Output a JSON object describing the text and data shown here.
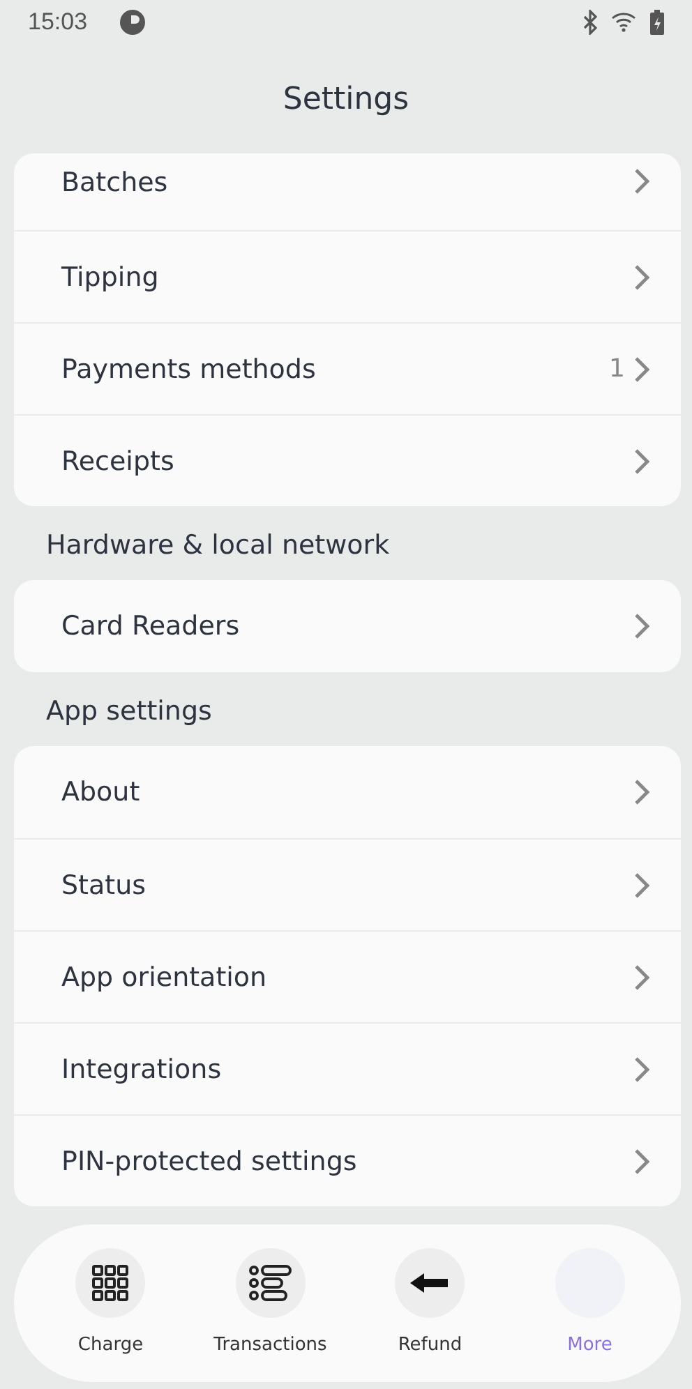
{
  "status_bar": {
    "time": "15:03"
  },
  "title": "Settings",
  "sections": [
    {
      "items": [
        {
          "label": "Batches"
        },
        {
          "label": "Tipping"
        },
        {
          "label": "Payments methods",
          "count": "1"
        },
        {
          "label": "Receipts"
        }
      ]
    },
    {
      "header": "Hardware & local network",
      "items": [
        {
          "label": "Card Readers"
        }
      ]
    },
    {
      "header": "App settings",
      "items": [
        {
          "label": "About"
        },
        {
          "label": "Status"
        },
        {
          "label": "App orientation"
        },
        {
          "label": "Integrations"
        },
        {
          "label": "PIN-protected settings"
        }
      ]
    }
  ],
  "nav": [
    {
      "label": "Charge",
      "kind": "grid",
      "selected": false
    },
    {
      "label": "Transactions",
      "kind": "list",
      "selected": false
    },
    {
      "label": "Refund",
      "kind": "arrow",
      "selected": false
    },
    {
      "label": "More",
      "kind": "none",
      "selected": true
    }
  ]
}
